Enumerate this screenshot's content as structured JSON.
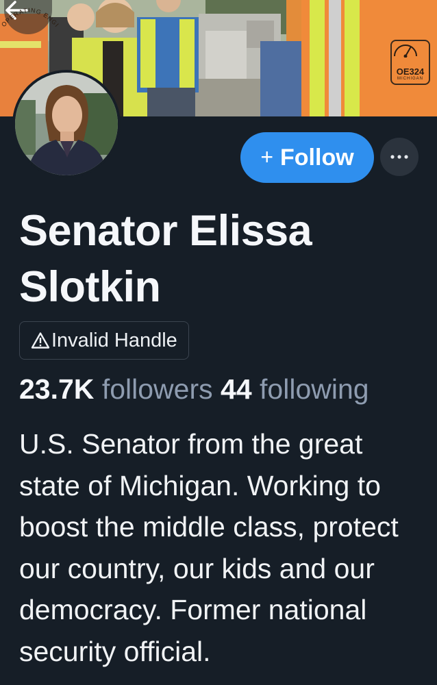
{
  "colors": {
    "background": "#161e27",
    "follow_button": "#2f8fee",
    "secondary_text": "#8e9cb0",
    "vest_orange": "#f08a3a",
    "vest_yellow": "#d8e84a"
  },
  "header": {
    "back_icon": "arrow-left-icon",
    "vest_logo": {
      "arc_text": "OPERATING ENGINEERS",
      "code": "OE324",
      "state": "MICHIGAN"
    }
  },
  "actions": {
    "follow_plus": "+",
    "follow_label": "Follow",
    "more_icon": "ellipsis-icon"
  },
  "profile": {
    "display_name": "Senator Elissa Slotkin",
    "handle_warning_icon": "warning-triangle-icon",
    "handle_label": "Invalid Handle",
    "followers_count": "23.7K",
    "followers_label": "followers",
    "following_count": "44",
    "following_label": "following",
    "bio": "U.S. Senator from the great state of Michigan. Working to boost the middle class, protect our country, our kids and our democracy. Former national security official."
  }
}
